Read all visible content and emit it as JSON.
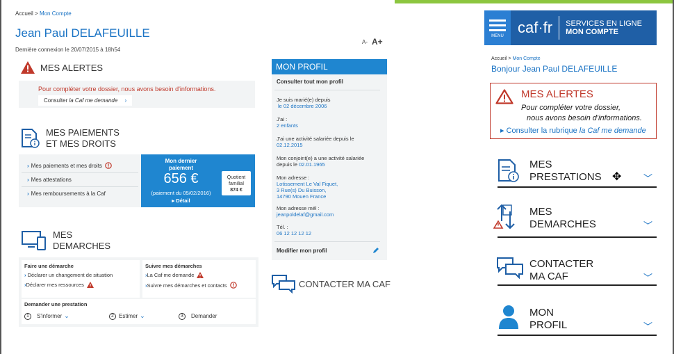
{
  "desktop": {
    "breadcrumb": {
      "home": "Accueil",
      "sep": ">",
      "current": "Mon Compte"
    },
    "user_name": "Jean Paul DELAFEUILLE",
    "last_login": "Dernière connexion le 20/07/2015 à 18h54",
    "font_smaller": "A-",
    "font_larger": "A+",
    "alerts": {
      "title": "MES ALERTES",
      "message": "Pour compléter votre dossier, nous avons besoin d'informations.",
      "link_prefix": "Consulter ",
      "link_italic": "la Caf me demande"
    },
    "payments": {
      "title_line1": "MES PAIEMENTS",
      "title_line2": "ET MES DROITS",
      "items": [
        "Mes paiements et mes droits",
        "Mes attestations",
        "Mes remboursements à la Caf"
      ],
      "last_payment_label_1": "Mon dernier",
      "last_payment_label_2": "paiement",
      "amount": "656 €",
      "payment_date": "(paiement du 05/02/2016)",
      "detail": "Détail",
      "quotient_label_1": "Quotient",
      "quotient_label_2": "familial",
      "quotient_value": "874 €"
    },
    "demarches": {
      "title_line1": "MES",
      "title_line2": "DEMARCHES",
      "faire_title": "Faire une démarche",
      "faire_items": [
        "Déclarer un changement de situation",
        "Déclarer mes ressources"
      ],
      "suivre_title": "Suivre mes démarches",
      "suivre_items": [
        "La Caf me demande",
        "Suivre mes démarches et contacts"
      ],
      "prestation_title": "Demander une prestation",
      "steps": [
        {
          "num": "1",
          "label": "S'informer"
        },
        {
          "num": "2",
          "label": "Estimer"
        },
        {
          "num": "3",
          "label": "Demander"
        }
      ]
    },
    "profile": {
      "title": "MON PROFIL",
      "see_all": "Consulter tout mon profil",
      "married_label": "Je suis marié(e) depuis",
      "married_value": "le 02 décembre 2006",
      "children_label": "J'ai :",
      "children_value": "2 enfants",
      "job_label": "J'ai une activité salariée depuis le",
      "job_value": "02.12.2015",
      "spouse_label_1": "Mon conjoint(e) a une activité salariée",
      "spouse_label_2": "depuis le",
      "spouse_value": "02.01.1965",
      "address_label": "Mon adresse :",
      "address_lines": [
        "Lotissement Le Val Fiquet,",
        "3 Rue(s) Du Buisson,",
        "14790 Mouen France"
      ],
      "email_label": "Mon adresse mél :",
      "email_value": "jeanpoldelaf@gmail.com",
      "phone_label": "Tél. :",
      "phone_value": "06 12 12 12 12",
      "edit": "Modifier mon profil"
    },
    "contact": "CONTACTER MA CAF"
  },
  "mobile": {
    "menu_label": "MENU",
    "logo": "caf·fr",
    "services_line1": "SERVICES EN LIGNE",
    "services_line2": "MON COMPTE",
    "breadcrumb": {
      "home": "Accueil",
      "sep": ">",
      "current": "Mon Compte"
    },
    "greeting": "Bonjour Jean Paul DELAFEUILLE",
    "alerts": {
      "title": "MES ALERTES",
      "line1": "Pour compléter votre dossier,",
      "line2": "nous avons besoin d'informations.",
      "link_prefix": "Consulter la rubrique ",
      "link_italic": "la Caf me demande"
    },
    "items": [
      {
        "line1": "MES",
        "line2": "PRESTATIONS"
      },
      {
        "line1": "MES",
        "line2": "DEMARCHES"
      },
      {
        "line1": "CONTACTER",
        "line2": "MA CAF"
      },
      {
        "line1": "MON",
        "line2": "PROFIL"
      }
    ]
  },
  "colors": {
    "primary": "#1f86d0",
    "header": "#1f5fa6",
    "alert": "#c0392b",
    "green": "#8cc63f"
  }
}
